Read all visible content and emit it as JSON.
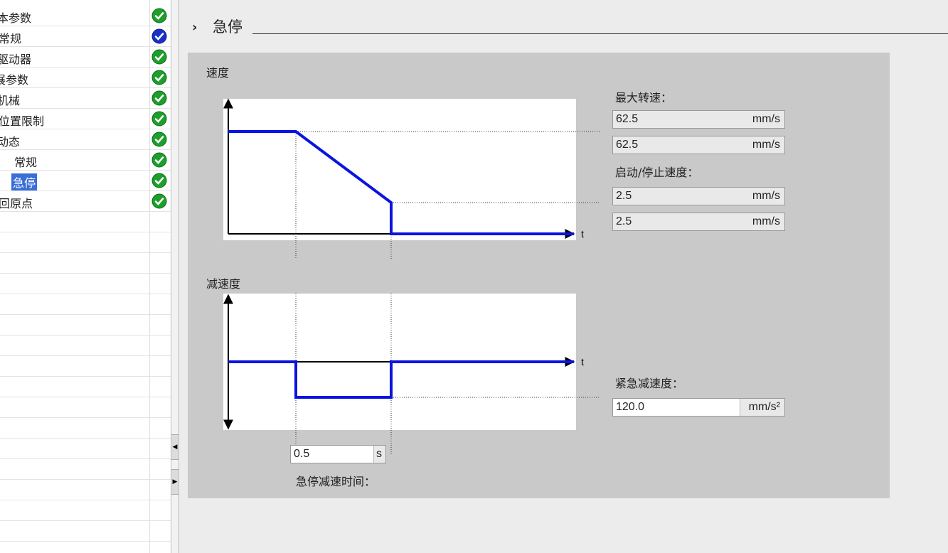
{
  "nav": {
    "items": [
      {
        "label": "本参数",
        "status": "ok",
        "indent": false,
        "selected": false
      },
      {
        "label": "常规",
        "status": "info",
        "indent": false,
        "selected": false
      },
      {
        "label": "驱动器",
        "status": "ok",
        "indent": false,
        "selected": false
      },
      {
        "label": "展参数",
        "status": "ok",
        "indent": false,
        "selected": false
      },
      {
        "label": "机械",
        "status": "ok",
        "indent": false,
        "selected": false
      },
      {
        "label": "位置限制",
        "status": "ok",
        "indent": false,
        "selected": false
      },
      {
        "label": "动态",
        "status": "ok",
        "indent": false,
        "selected": false
      },
      {
        "label": "常规",
        "status": "ok",
        "indent": true,
        "selected": false
      },
      {
        "label": "急停",
        "status": "ok",
        "indent": true,
        "selected": true
      },
      {
        "label": "回原点",
        "status": "ok",
        "indent": false,
        "selected": false
      }
    ]
  },
  "header": {
    "chevron": "›",
    "title": "急停"
  },
  "panel": {
    "velocity_label": "速度",
    "decel_label": "减速度",
    "t_axis": "t",
    "max_speed_label": "最大转速：",
    "start_stop_label": "启动/停止速度：",
    "emergency_decel_label": "紧急减速度：",
    "emergency_time_label": "急停减速时间："
  },
  "fields": {
    "max_speed_1": {
      "value": "62.5",
      "unit": "mm/s"
    },
    "max_speed_2": {
      "value": "62.5",
      "unit": "mm/s"
    },
    "start_stop_1": {
      "value": "2.5",
      "unit": "mm/s"
    },
    "start_stop_2": {
      "value": "2.5",
      "unit": "mm/s"
    },
    "emergency_decel": {
      "value": "120.0",
      "unit": "mm/s²"
    },
    "emergency_time": {
      "value": "0.5",
      "unit": "s"
    }
  },
  "colors": {
    "curve": "#0a14e0",
    "ok_icon": "#1e9e2c",
    "info_icon": "#1a2fc8",
    "selected": "#3a6fd8"
  }
}
